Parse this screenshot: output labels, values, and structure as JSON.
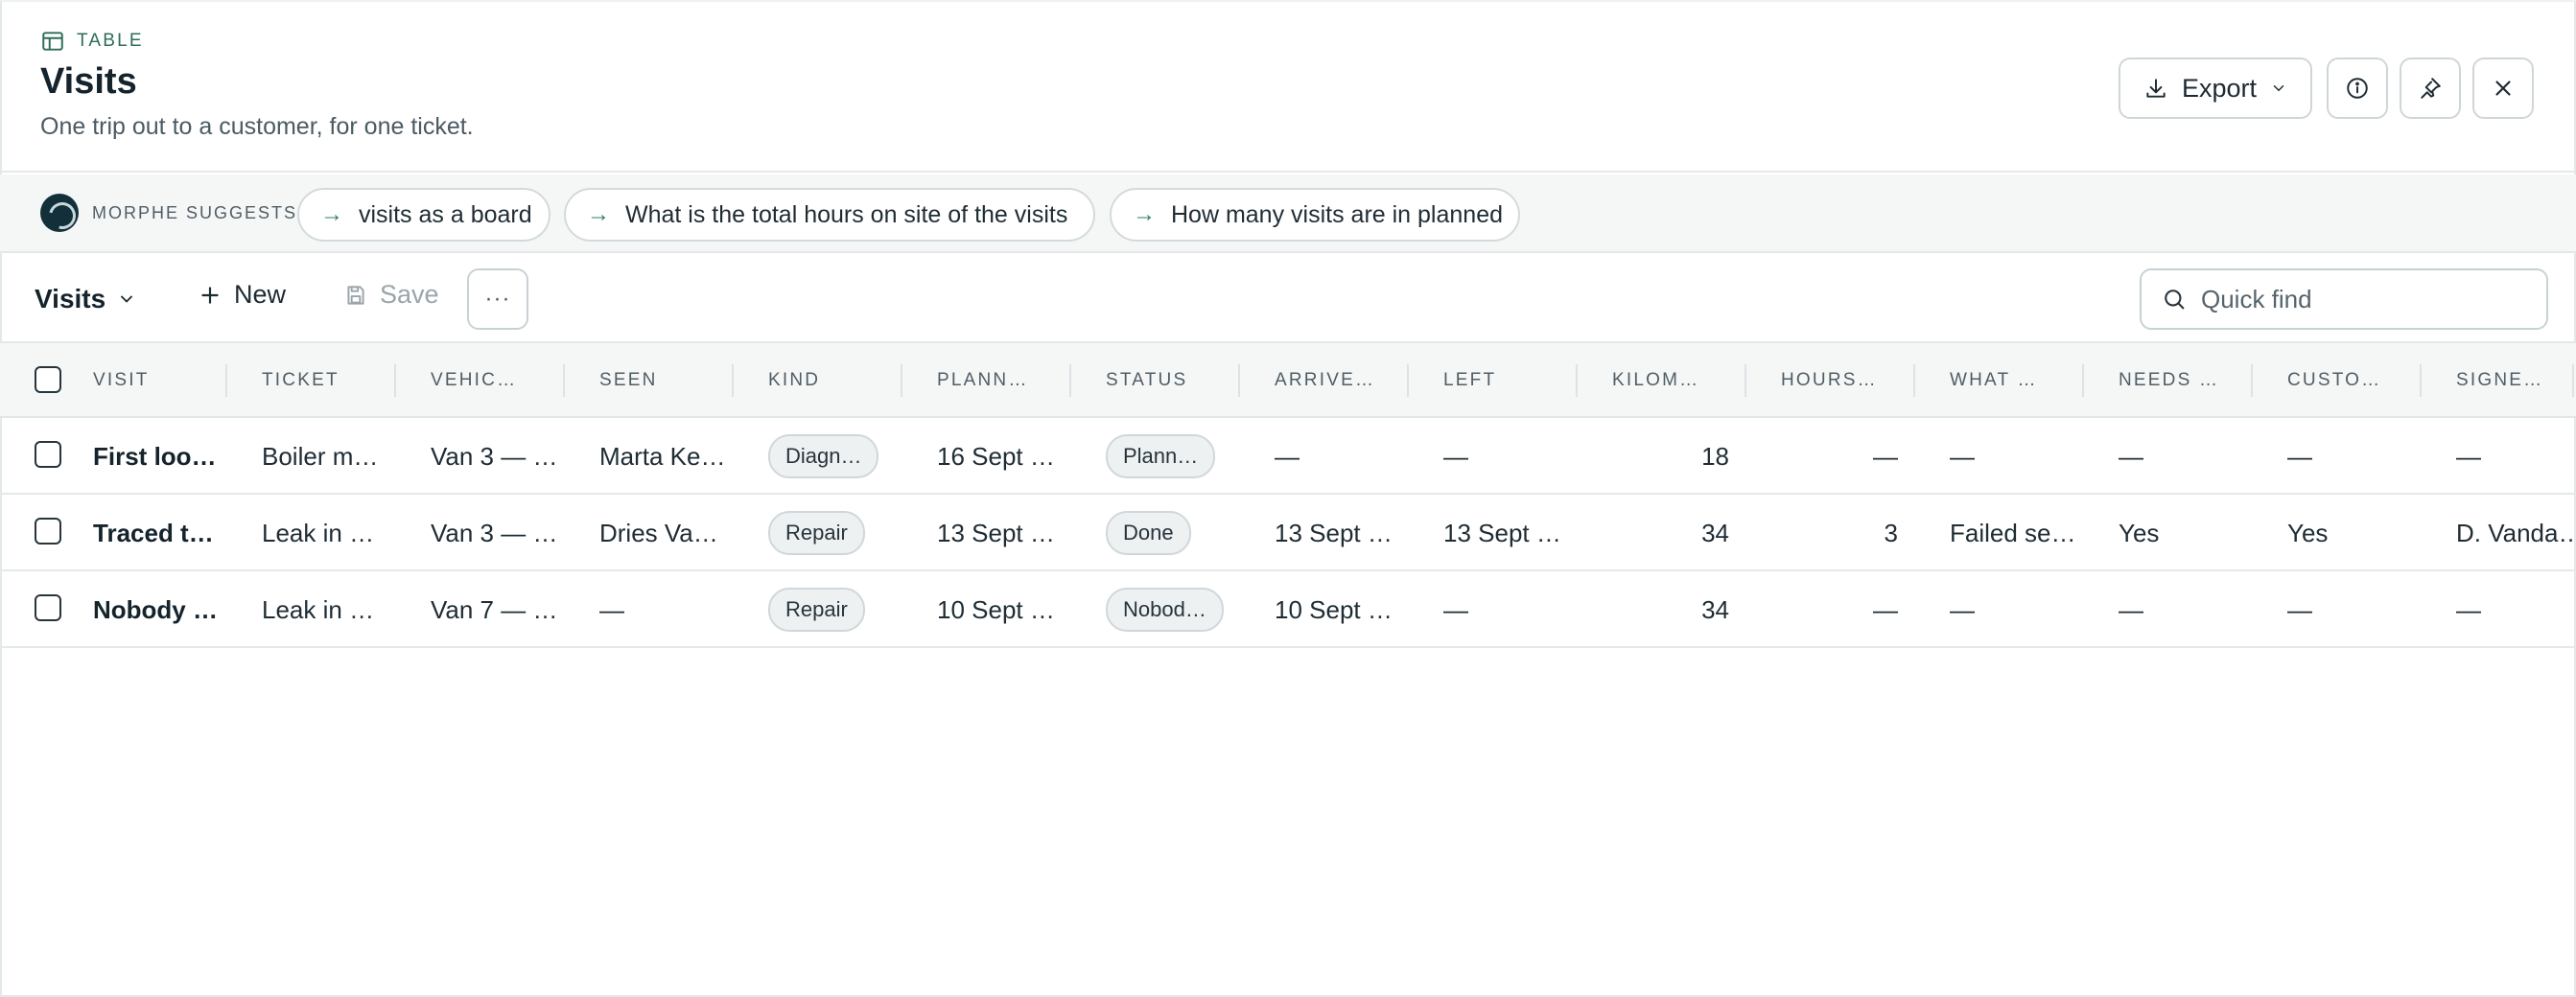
{
  "header": {
    "eyebrow": "TABLE",
    "title": "Visits",
    "subtitle": "One trip out to a customer, for one ticket.",
    "export_label": "Export"
  },
  "suggestions": {
    "label": "MORPHE SUGGESTS",
    "items": [
      {
        "label": "visits as a board"
      },
      {
        "label": "What is the total hours on site of the visits"
      },
      {
        "label": "How many visits are in planned"
      }
    ],
    "arrow": "→"
  },
  "toolbar": {
    "view_label": "Visits",
    "new_label": "New",
    "save_label": "Save",
    "more_label": "···",
    "search_placeholder": "Quick find"
  },
  "table": {
    "columns": [
      "VISIT",
      "TICKET",
      "VEHIC…",
      "SEEN",
      "KIND",
      "PLANN…",
      "STATUS",
      "ARRIVE…",
      "LEFT",
      "KILOM…",
      "HOURS…",
      "WHAT …",
      "NEEDS …",
      "CUSTO…",
      "SIGNE…"
    ],
    "rows": [
      [
        "First loo…",
        "Boiler m…",
        "Van 3 — …",
        "Marta Ke…",
        "Diagn…",
        "16 Sept …",
        "Plann…",
        "—",
        "—",
        "18",
        "—",
        "—",
        "—",
        "—",
        "—"
      ],
      [
        "Traced t…",
        "Leak in …",
        "Van 3 — …",
        "Dries Va…",
        "Repair",
        "13 Sept …",
        "Done",
        "13 Sept …",
        "13 Sept …",
        "34",
        "3",
        "Failed se…",
        "Yes",
        "Yes",
        "D. Vanda…"
      ],
      [
        "Nobody …",
        "Leak in …",
        "Van 7 — …",
        "—",
        "Repair",
        "10 Sept …",
        "Nobod…",
        "10 Sept …",
        "—",
        "34",
        "—",
        "—",
        "—",
        "—",
        "—"
      ]
    ]
  },
  "colors": {
    "accent": "#2c6e55",
    "border": "#e4e8ea",
    "header_bg": "#f5f7f7"
  }
}
